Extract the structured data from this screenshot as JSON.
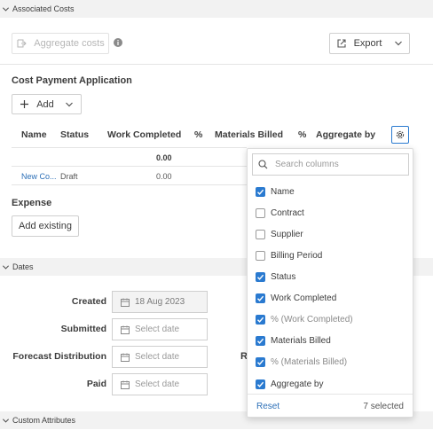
{
  "sections": {
    "associated_costs": "Associated Costs",
    "dates": "Dates",
    "custom_attributes": "Custom Attributes"
  },
  "toolbar": {
    "aggregate_costs": "Aggregate costs",
    "export": "Export"
  },
  "cost_payment": {
    "title": "Cost Payment Application",
    "add_label": "Add",
    "columns": [
      "Name",
      "Status",
      "Work Completed",
      "%",
      "Materials Billed",
      "%",
      "Aggregate by"
    ],
    "totals": {
      "work_completed": "0.00"
    },
    "row": {
      "name": "New Co...",
      "status": "Draft",
      "work_completed": "0.00"
    }
  },
  "expense": {
    "title": "Expense",
    "add_existing": "Add existing"
  },
  "dates": {
    "created_label": "Created",
    "created_value": "18 Aug 2023",
    "submitted_label": "Submitted",
    "forecast_label": "Forecast Distribution",
    "paid_label": "Paid",
    "placeholder": "Select date",
    "truncated_label": "R"
  },
  "column_picker": {
    "search_placeholder": "Search columns",
    "options": [
      {
        "label": "Name",
        "checked": true
      },
      {
        "label": "Contract",
        "checked": false
      },
      {
        "label": "Supplier",
        "checked": false
      },
      {
        "label": "Billing Period",
        "checked": false
      },
      {
        "label": "Status",
        "checked": true
      },
      {
        "label": "Work Completed",
        "checked": true
      },
      {
        "label": "% (Work Completed)",
        "checked": true
      },
      {
        "label": "Materials Billed",
        "checked": true
      },
      {
        "label": "% (Materials Billed)",
        "checked": true
      },
      {
        "label": "Aggregate by",
        "checked": true
      }
    ],
    "reset": "Reset",
    "selected_count": "7 selected"
  },
  "colors": {
    "accent": "#2a7ad0",
    "link": "#2c6fb7",
    "section_bg": "#f2f2f2"
  }
}
